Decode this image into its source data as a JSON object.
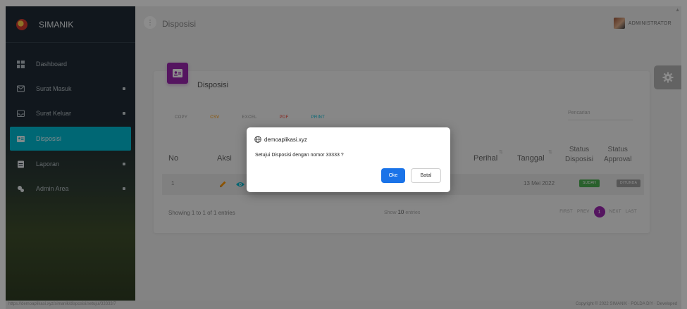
{
  "sidebar": {
    "brand": "SIMANIK",
    "items": [
      {
        "label": "Dashboard",
        "icon": "dashboard-icon"
      },
      {
        "label": "Surat Masuk",
        "icon": "inbox-icon",
        "has_caret": true
      },
      {
        "label": "Surat Keluar",
        "icon": "outbox-icon",
        "has_caret": true
      },
      {
        "label": "Disposisi",
        "icon": "disposisi-icon",
        "active": true
      },
      {
        "label": "Laporan",
        "icon": "report-icon",
        "has_caret": true
      },
      {
        "label": "Admin Area",
        "icon": "admin-icon",
        "has_caret": true
      }
    ]
  },
  "header": {
    "title": "Disposisi",
    "user": "ADMINISTRATOR"
  },
  "card": {
    "title": "Disposisi",
    "export_buttons": [
      "COPY",
      "CSV",
      "EXCEL",
      "PDF",
      "PRINT"
    ],
    "search_placeholder": "Pencarian",
    "columns": {
      "no": "No",
      "aksi": "Aksi",
      "perihal": "Perihal",
      "tanggal": "Tanggal",
      "status_disposisi_1": "Status",
      "status_disposisi_2": "Disposisi",
      "status_approval_1": "Status",
      "status_approval_2": "Approval"
    },
    "rows": [
      {
        "no": "1",
        "tanggal": "13 Mei 2022",
        "status_disposisi": "SUDAH",
        "status_approval": "DITUNDA"
      }
    ],
    "info": "Showing 1 to 1 of 1 entries",
    "length_prefix": "Show",
    "length_value": "10",
    "length_suffix": "entries",
    "pagination": {
      "first": "FIRST",
      "prev": "PREV",
      "current": "1",
      "next": "NEXT",
      "last": "LAST"
    }
  },
  "footer": {
    "url": "https://demoaplikasi.xyz/simanik/disposisi/setujui/33333/7",
    "copyright": "Copyright © 2022 SIMANIK · POLDA DIY · Developed"
  },
  "dialog": {
    "site": "demoaplikasi.xyz",
    "message": "Setujui Disposisi dengan nomor 33333 ?",
    "ok": "Oke",
    "cancel": "Batal"
  },
  "colors": {
    "sidebar_active": "#00bcd4",
    "card_accent": "#9c27b0",
    "status_done": "#4caf50",
    "dialog_ok": "#1a73e8"
  }
}
